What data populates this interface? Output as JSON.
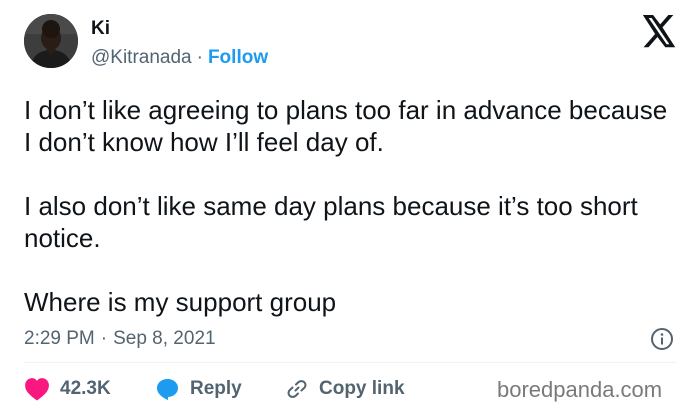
{
  "author": {
    "display_name": "Ki",
    "handle": "@Kitranada",
    "separator": "·",
    "follow_label": "Follow"
  },
  "tweet": {
    "paragraphs": [
      "I don’t like agreeing to plans too far in advance because I don’t know how I’ll feel day of.",
      "I also don’t like same day plans because it’s too short notice.",
      "Where is my support group"
    ],
    "time": "2:29 PM",
    "separator": "·",
    "date": "Sep 8, 2021"
  },
  "actions": {
    "like_count": "42.3K",
    "reply_label": "Reply",
    "copy_link_label": "Copy link"
  },
  "watermark": "boredpanda.com",
  "colors": {
    "accent": "#1d9bf0",
    "like": "#f91880",
    "text": "#0f1419",
    "secondary_text": "#536471"
  },
  "icons": {
    "brand": "x-logo-icon",
    "info": "info-icon",
    "like": "heart-icon",
    "reply": "reply-bubble-icon",
    "copy": "link-icon"
  }
}
